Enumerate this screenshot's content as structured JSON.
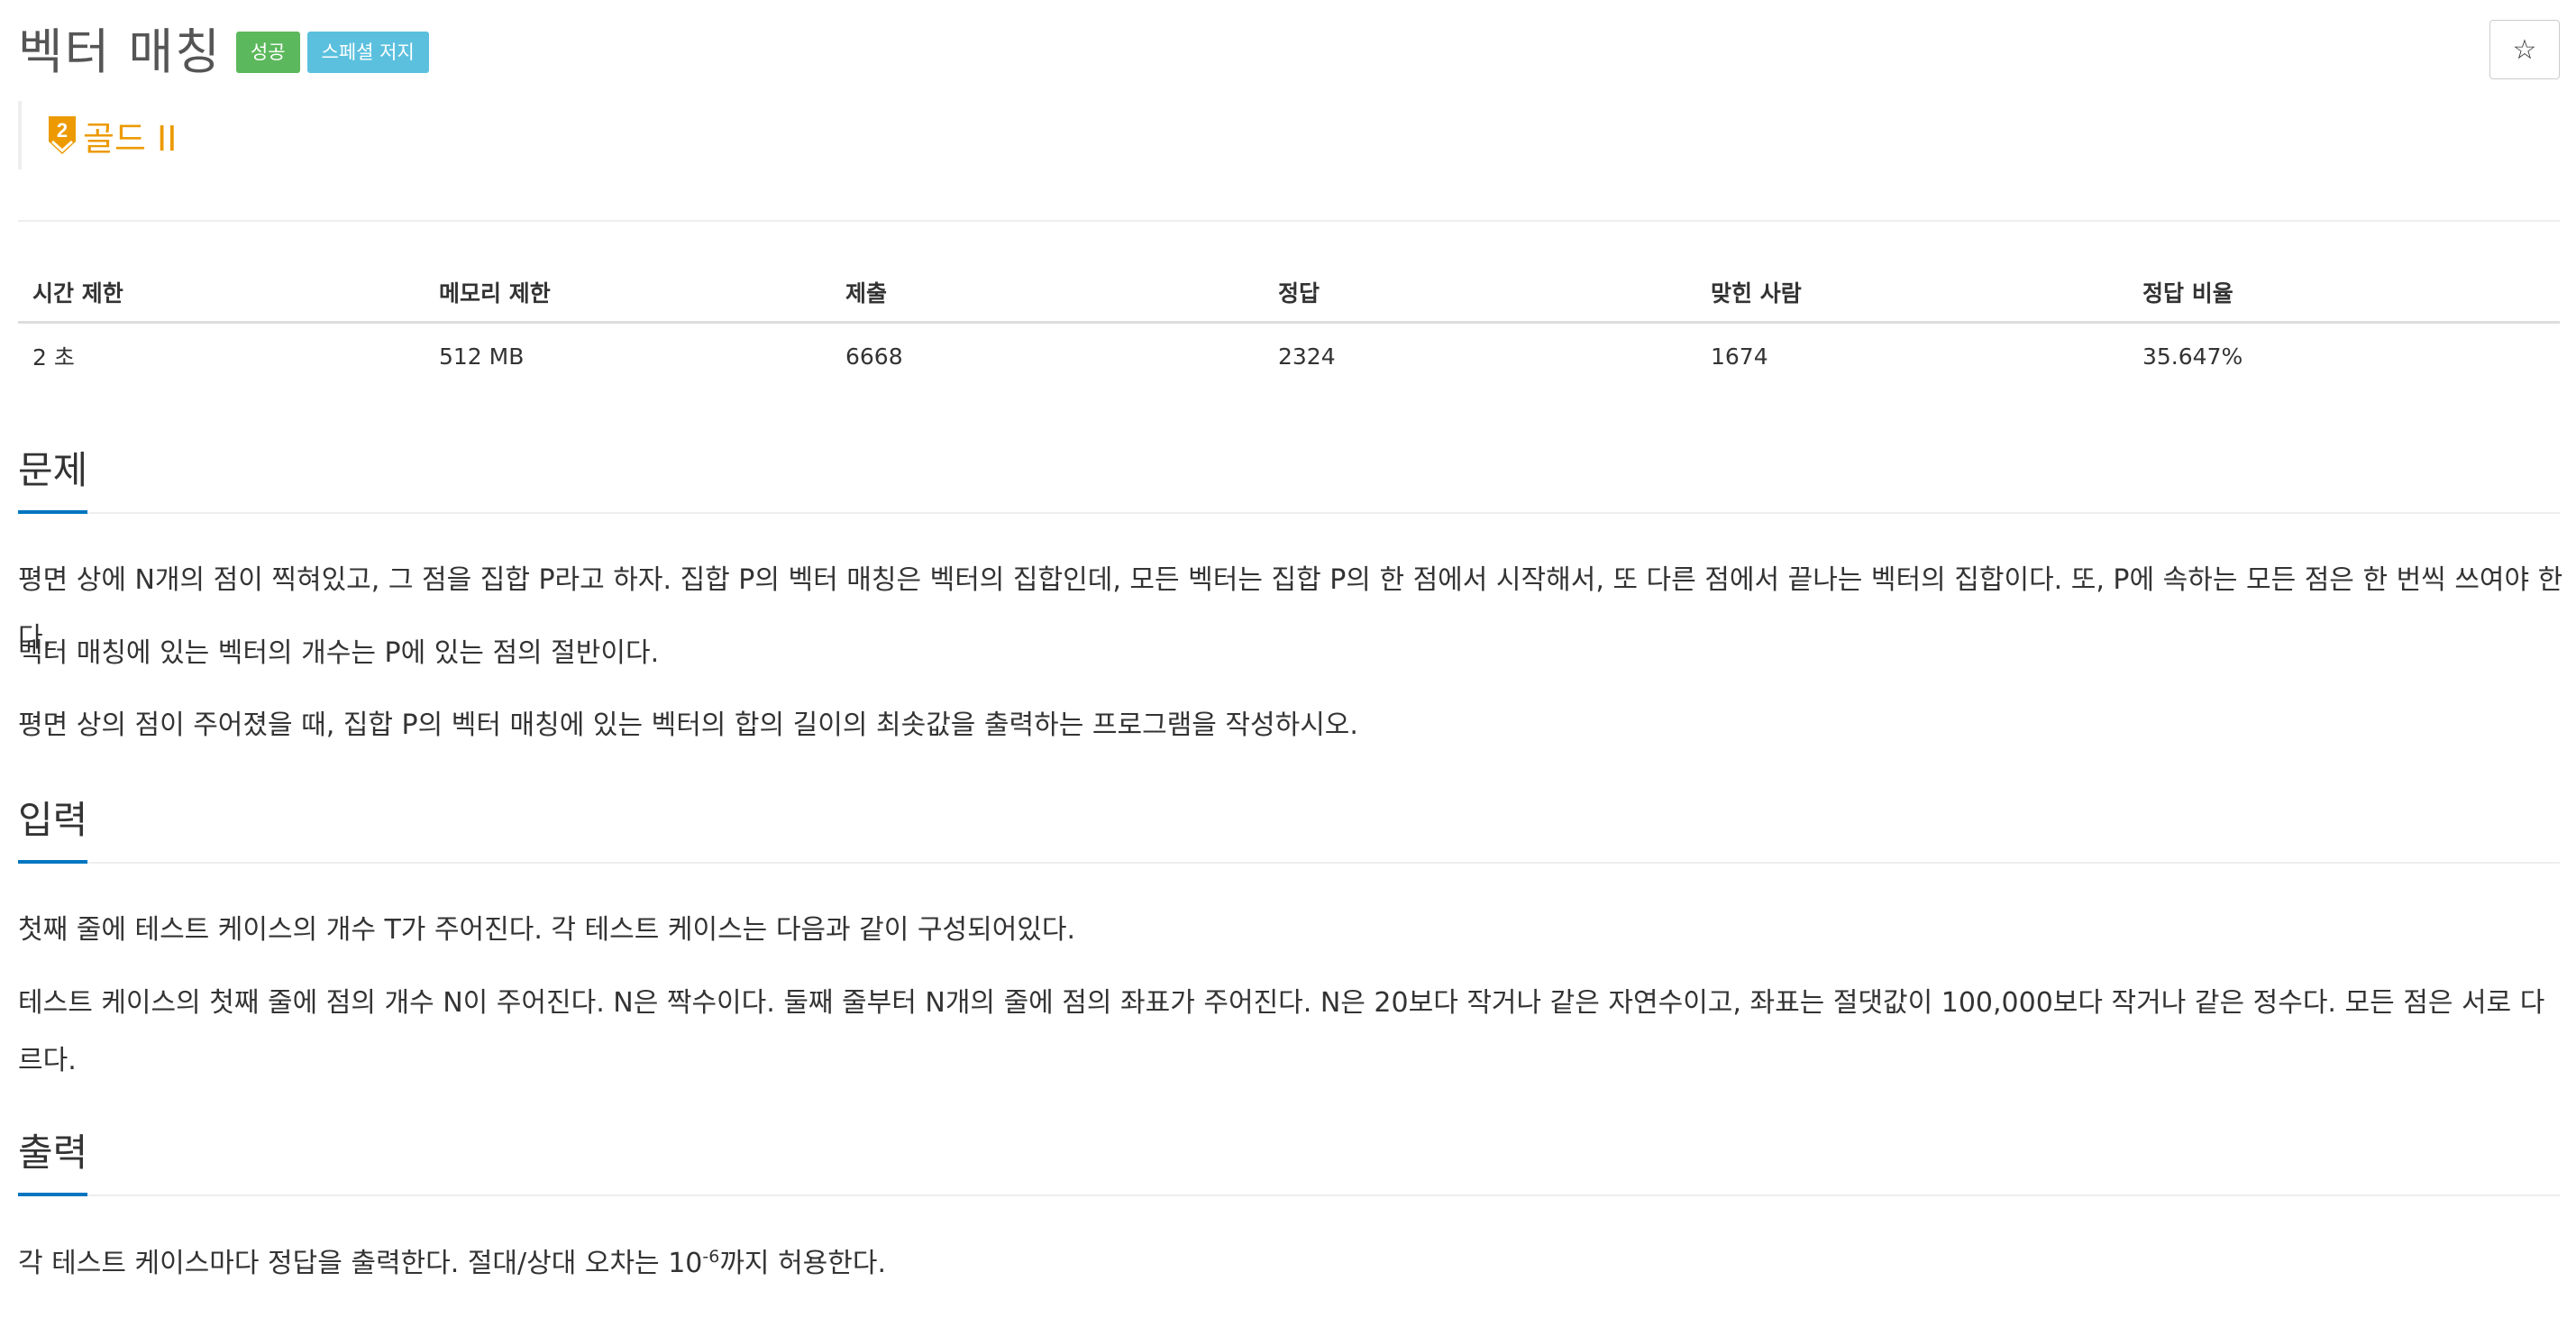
{
  "header": {
    "title": "벡터 매칭",
    "badges": {
      "success": "성공",
      "special_judge": "스페셜 저지"
    },
    "star_icon": "☆",
    "tier": {
      "icon": "gold-tier-icon",
      "number": "2",
      "text": "골드 II",
      "color": "#ec9a00"
    }
  },
  "info_table": {
    "headers": [
      "시간 제한",
      "메모리 제한",
      "제출",
      "정답",
      "맞힌 사람",
      "정답 비율"
    ],
    "values": [
      "2 초",
      "512 MB",
      "6668",
      "2324",
      "1674",
      "35.647%"
    ]
  },
  "sections": {
    "problem": {
      "title": "문제",
      "paragraphs": [
        "평면 상에 N개의 점이 찍혀있고, 그 점을 집합 P라고 하자. 집합 P의 벡터 매칭은 벡터의 집합인데, 모든 벡터는 집합 P의 한 점에서 시작해서, 또 다른 점에서 끝나는 벡터의 집합이다. 또, P에 속하는 모든 점은 한 번씩 쓰여야 한다.",
        "벡터 매칭에 있는 벡터의 개수는 P에 있는 점의 절반이다.",
        "평면 상의 점이 주어졌을 때, 집합 P의 벡터 매칭에 있는 벡터의 합의 길이의 최솟값을 출력하는 프로그램을 작성하시오."
      ]
    },
    "input": {
      "title": "입력",
      "paragraphs": [
        "첫째 줄에 테스트 케이스의 개수 T가 주어진다. 각 테스트 케이스는 다음과 같이 구성되어있다.",
        "테스트 케이스의 첫째 줄에 점의 개수 N이 주어진다. N은 짝수이다. 둘째 줄부터 N개의 줄에 점의 좌표가 주어진다. N은 20보다 작거나 같은 자연수이고, 좌표는 절댓값이 100,000보다 작거나 같은 정수다. 모든 점은 서로 다르다."
      ]
    },
    "output": {
      "title": "출력",
      "text_before": "각 테스트 케이스마다 정답을 출력한다. 절대/상대 오차는 10",
      "superscript": "-6",
      "text_after": "까지 허용한다."
    }
  },
  "colors": {
    "success_badge": "#5cb85c",
    "special_judge_badge": "#5bc0de",
    "section_underline": "#0076c0"
  }
}
